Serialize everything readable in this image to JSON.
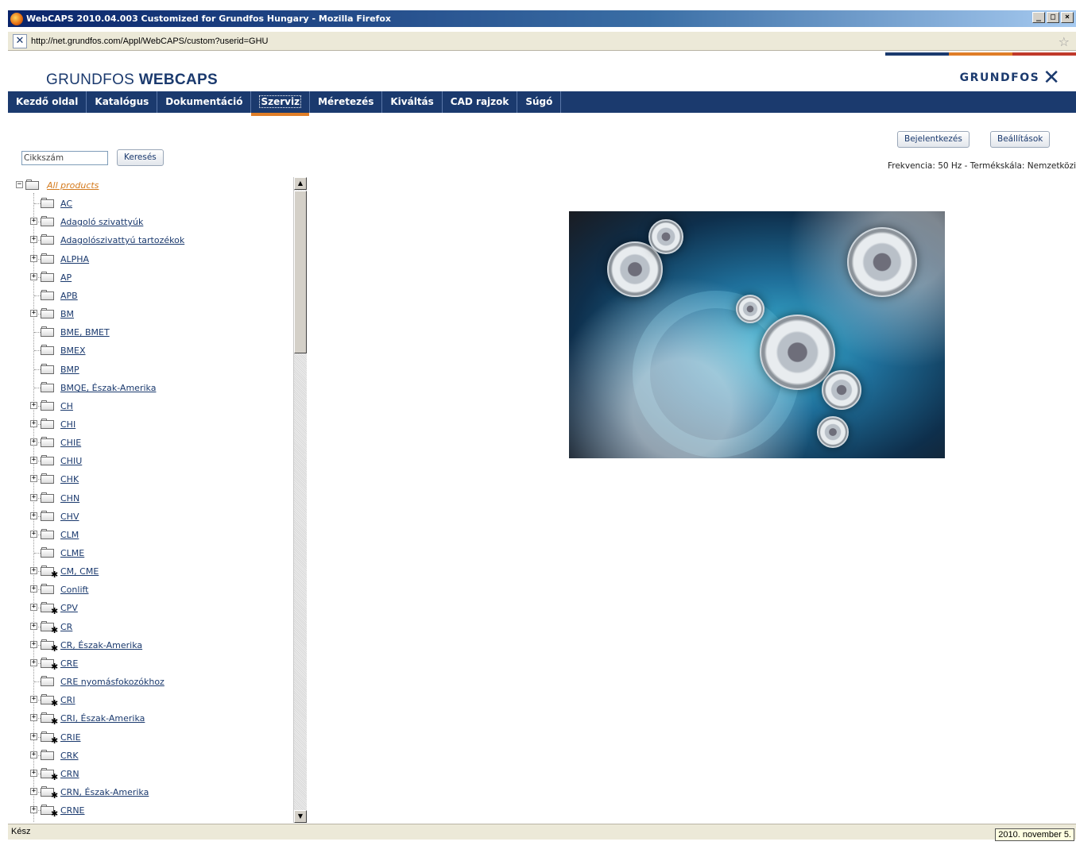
{
  "window": {
    "title": "WebCAPS 2010.04.003 Customized for Grundfos Hungary - Mozilla Firefox",
    "min_glyph": "_",
    "max_glyph": "□",
    "close_glyph": "×"
  },
  "address_bar": {
    "url": "http://net.grundfos.com/Appl/WebCAPS/custom?userid=GHU",
    "bookmark_icon": "star-icon"
  },
  "header": {
    "brand_light": "GRUNDFOS ",
    "brand_bold": "WEBCAPS",
    "logo_word": "GRUNDFOS",
    "logo_mark_icon": "grundfos-x-logo",
    "accent_colors": [
      "#1b3a6e",
      "#e07e27",
      "#c0392b"
    ]
  },
  "nav": {
    "items": [
      {
        "label": "Kezdő oldal",
        "active": false
      },
      {
        "label": "Katalógus",
        "active": false
      },
      {
        "label": "Dokumentáció",
        "active": false
      },
      {
        "label": "Szerviz",
        "active": true
      },
      {
        "label": "Méretezés",
        "active": false
      },
      {
        "label": "Kiváltás",
        "active": false
      },
      {
        "label": "CAD rajzok",
        "active": false
      },
      {
        "label": "Súgó",
        "active": false
      }
    ]
  },
  "toolbar": {
    "search_placeholder": "Cikkszám",
    "search_button": "Keresés",
    "login_button": "Bejelentkezés",
    "settings_button": "Beállítások",
    "frequency_text": "Frekvencia: 50 Hz - Termékskála: Nemzetközi"
  },
  "tree": {
    "root": "All products",
    "items": [
      {
        "label": "AC",
        "expandable": false,
        "special": false
      },
      {
        "label": "Adagoló szivattyúk",
        "expandable": true,
        "special": false
      },
      {
        "label": "Adagolószivattyú tartozékok",
        "expandable": true,
        "special": false
      },
      {
        "label": "ALPHA",
        "expandable": true,
        "special": false
      },
      {
        "label": "AP",
        "expandable": true,
        "special": false
      },
      {
        "label": "APB",
        "expandable": false,
        "special": false
      },
      {
        "label": "BM",
        "expandable": true,
        "special": false
      },
      {
        "label": "BME, BMET",
        "expandable": false,
        "special": false
      },
      {
        "label": "BMEX",
        "expandable": false,
        "special": false
      },
      {
        "label": "BMP",
        "expandable": false,
        "special": false
      },
      {
        "label": "BMQE, Észak-Amerika",
        "expandable": false,
        "special": false
      },
      {
        "label": "CH",
        "expandable": true,
        "special": false
      },
      {
        "label": "CHI",
        "expandable": true,
        "special": false
      },
      {
        "label": "CHIE",
        "expandable": true,
        "special": false
      },
      {
        "label": "CHIU",
        "expandable": true,
        "special": false
      },
      {
        "label": "CHK",
        "expandable": true,
        "special": false
      },
      {
        "label": "CHN",
        "expandable": true,
        "special": false
      },
      {
        "label": "CHV",
        "expandable": true,
        "special": false
      },
      {
        "label": "CLM",
        "expandable": true,
        "special": false
      },
      {
        "label": "CLME",
        "expandable": false,
        "special": false
      },
      {
        "label": "CM, CME",
        "expandable": true,
        "special": true
      },
      {
        "label": "Conlift",
        "expandable": true,
        "special": false
      },
      {
        "label": "CPV",
        "expandable": true,
        "special": true
      },
      {
        "label": "CR",
        "expandable": true,
        "special": true
      },
      {
        "label": "CR, Észak-Amerika",
        "expandable": true,
        "special": true
      },
      {
        "label": "CRE",
        "expandable": true,
        "special": true
      },
      {
        "label": "CRE nyomásfokozókhoz",
        "expandable": false,
        "special": false
      },
      {
        "label": "CRI",
        "expandable": true,
        "special": true
      },
      {
        "label": "CRI, Észak-Amerika",
        "expandable": true,
        "special": true
      },
      {
        "label": "CRIE",
        "expandable": true,
        "special": true
      },
      {
        "label": "CRK",
        "expandable": true,
        "special": false
      },
      {
        "label": "CRN",
        "expandable": true,
        "special": true
      },
      {
        "label": "CRN, Észak-Amerika",
        "expandable": true,
        "special": true
      },
      {
        "label": "CRNE",
        "expandable": true,
        "special": true
      }
    ]
  },
  "status_bar": {
    "status": "Kész",
    "date": "2010. november 5."
  }
}
